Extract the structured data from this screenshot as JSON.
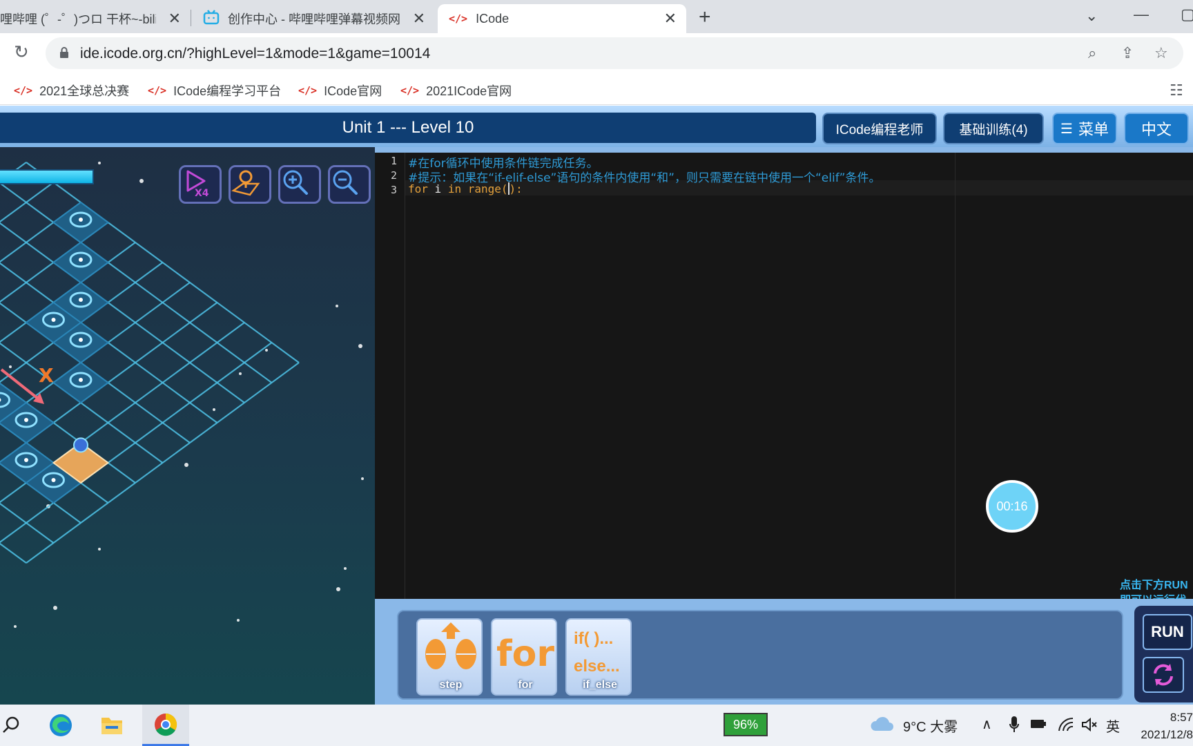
{
  "browser": {
    "tabs": [
      {
        "title": "哩哔哩 (゜-゜)つロ 干杯~-bilil",
        "active": false
      },
      {
        "title": "创作中心 - 哔哩哔哩弹幕视频网",
        "active": false
      },
      {
        "title": "ICode",
        "active": true
      }
    ],
    "url": "ide.icode.org.cn/?highLevel=1&mode=1&game=10014",
    "bookmarks": [
      "2021全球总决赛",
      "ICode编程学习平台",
      "ICode官网",
      "2021ICode官网"
    ]
  },
  "app": {
    "level_title": "Unit 1 --- Level 10",
    "header_buttons": {
      "teacher": "ICode编程老师",
      "training": "基础训练(4)",
      "menu": "菜单",
      "language": "中文"
    },
    "board": {
      "speed_label": "X4",
      "marker_label": "X"
    },
    "editor": {
      "line_numbers": [
        "1",
        "2",
        "3"
      ],
      "line1": "#在for循环中使用条件链完成任务。",
      "line2": "#提示：如果在“if-elif-else”语句的条件内使用“和”，则只需要在链中使用一个“elif”条件。",
      "line3_kw1": "for",
      "line3_rest": " i ",
      "line3_kw2": "in",
      "line3_call": " range(",
      "line3_end": "):"
    },
    "timer": "00:16",
    "hint_line1": "点击下方RUN",
    "hint_line2": "即可以运行代",
    "blocks": [
      {
        "label": "step"
      },
      {
        "label": "for",
        "glyph": "for"
      },
      {
        "label": "if_else",
        "glyph_line1": "if( )...",
        "glyph_line2": "else..."
      }
    ],
    "run_label": "RUN"
  },
  "taskbar": {
    "battery": "96%",
    "weather": "9°C 大雾",
    "ime": "英",
    "time": "8:57",
    "date": "2021/12/8"
  },
  "colors": {
    "header_dark": "#0f3e73",
    "accent_orange": "#f39a35",
    "comment_blue": "#2f9bd6",
    "grid_line": "#4fc3e8"
  }
}
